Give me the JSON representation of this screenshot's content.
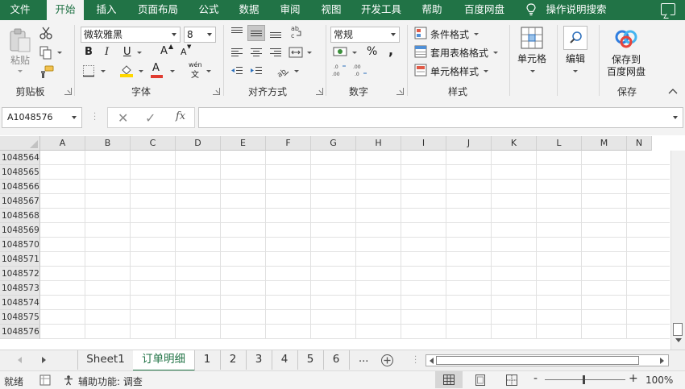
{
  "menu": {
    "items": [
      "文件",
      "开始",
      "插入",
      "页面布局",
      "公式",
      "数据",
      "审阅",
      "视图",
      "开发工具",
      "帮助",
      "百度网盘"
    ],
    "active": "开始",
    "tell_me": "操作说明搜索"
  },
  "ribbon": {
    "clipboard": {
      "paste_label": "粘贴",
      "group_label": "剪贴板"
    },
    "font": {
      "font_name": "微软雅黑",
      "font_size": "8",
      "bold": "B",
      "italic": "I",
      "underline": "U",
      "grow": "A",
      "shrink": "A",
      "fill_letter": "A",
      "wen": "wén",
      "group_label": "字体"
    },
    "alignment": {
      "group_label": "对齐方式"
    },
    "number": {
      "format": "常规",
      "percent": "%",
      "comma": ",",
      "group_label": "数字"
    },
    "styles": {
      "conditional": "条件格式",
      "table": "套用表格格式",
      "cell_styles": "单元格样式",
      "group_label": "样式"
    },
    "cells": {
      "label": "单元格"
    },
    "editing": {
      "label": "编辑"
    },
    "baidu": {
      "label_line1": "保存到",
      "label_line2": "百度网盘",
      "group_label": "保存"
    }
  },
  "formula_bar": {
    "name_box": "A1048576",
    "fx": "fx",
    "formula": ""
  },
  "grid": {
    "columns": [
      "A",
      "B",
      "C",
      "D",
      "E",
      "F",
      "G",
      "H",
      "I",
      "J",
      "K",
      "L",
      "M",
      "N"
    ],
    "rows": [
      "1048564",
      "1048565",
      "1048566",
      "1048567",
      "1048568",
      "1048569",
      "1048570",
      "1048571",
      "1048572",
      "1048573",
      "1048574",
      "1048575",
      "1048576"
    ]
  },
  "sheets": {
    "tabs": [
      "Sheet1",
      "订单明细",
      "1",
      "2",
      "3",
      "4",
      "5",
      "6"
    ],
    "active": "订单明细",
    "more": "..."
  },
  "status": {
    "ready": "就绪",
    "accessibility": "辅助功能: 调查",
    "zoom": "100%",
    "minus": "-",
    "plus": "+"
  },
  "colors": {
    "accent": "#217346"
  }
}
